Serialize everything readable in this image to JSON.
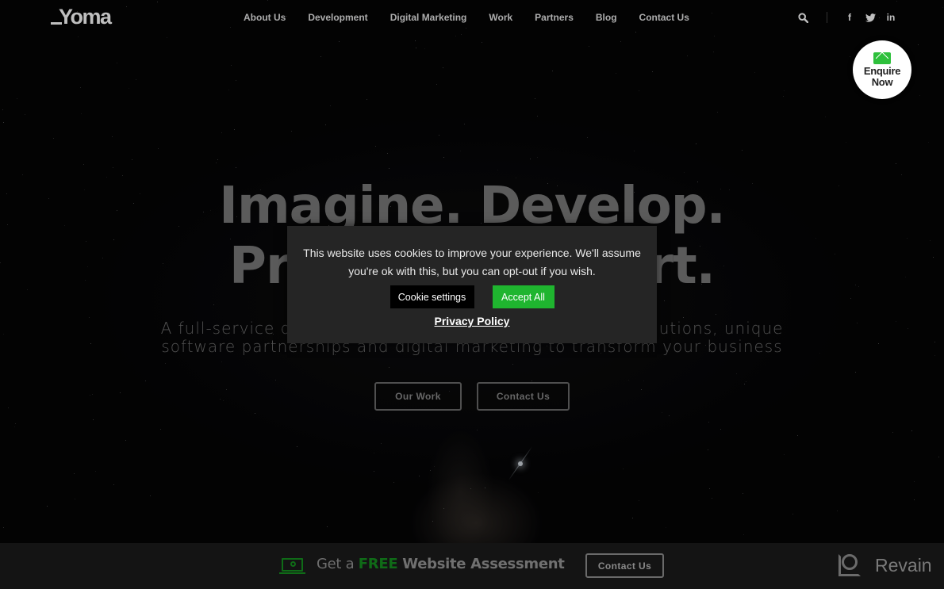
{
  "header": {
    "logo": "Yoma",
    "nav": [
      "About Us",
      "Development",
      "Digital Marketing",
      "Work",
      "Partners",
      "Blog",
      "Contact Us"
    ],
    "icons": {
      "search": "search-icon",
      "facebook": "f",
      "twitter": "twitter-icon",
      "linkedin": "in"
    }
  },
  "enquire": {
    "line1": "Enquire",
    "line2": "Now",
    "accent": "#2ec03c"
  },
  "hero": {
    "title_line1": "Imagine. Develop.",
    "title_line2_visible_start": "Pr",
    "title_line2_visible_end": "rt.",
    "subtitle_line1_visible_start": "A full-service dig",
    "subtitle_line1_visible_end": "olutions, unique",
    "subtitle_line2": "software partnerships and digital marketing to transform your business",
    "buttons": [
      "Our Work",
      "Contact Us"
    ]
  },
  "cookie": {
    "message": "This website uses cookies to improve your experience. We'll assume you're ok with this, but you can opt-out if you wish.",
    "settings_label": "Cookie settings",
    "accept_label": "Accept All",
    "privacy_label": "Privacy Policy",
    "accept_color": "#1fb52f"
  },
  "bottom_bar": {
    "text_prefix": "Get a ",
    "text_free": "FREE",
    "text_rest": " Website Assessment",
    "button_label": "Contact Us",
    "free_color": "#0f6b17"
  },
  "watermark": {
    "label": "Revain"
  }
}
